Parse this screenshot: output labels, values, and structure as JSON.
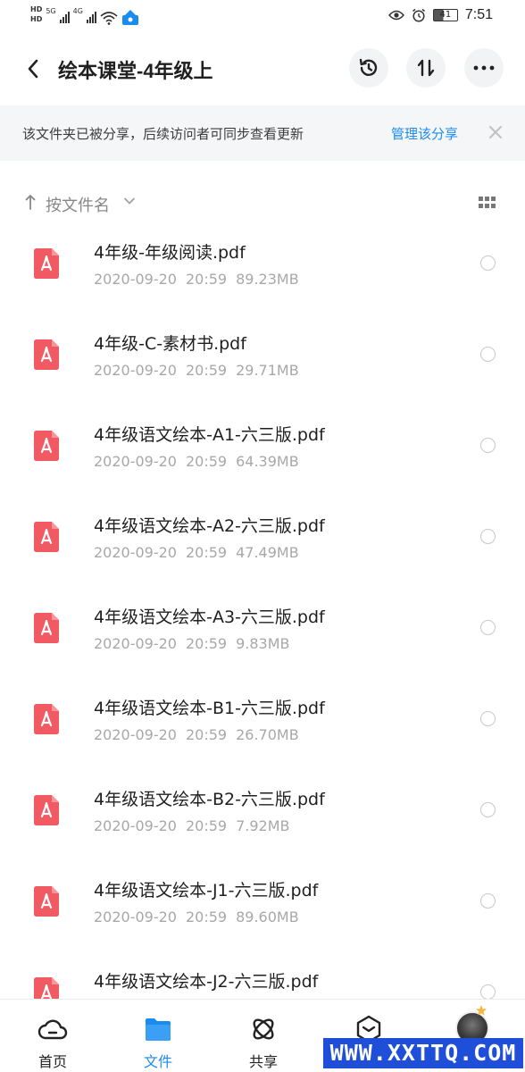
{
  "status_bar": {
    "hd_tags": [
      "HD",
      "HD"
    ],
    "network": [
      "5G",
      "4G"
    ],
    "battery": "41",
    "time": "7:51"
  },
  "header": {
    "title": "绘本课堂-4年级上"
  },
  "share_banner": {
    "message": "该文件夹已被分享，后续访问者可同步查看更新",
    "manage_label": "管理该分享"
  },
  "sort": {
    "label": "按文件名"
  },
  "files": [
    {
      "name": "4年级-年级阅读.pdf",
      "date": "2020-09-20",
      "time": "20:59",
      "size": "89.23MB"
    },
    {
      "name": "4年级-C-素材书.pdf",
      "date": "2020-09-20",
      "time": "20:59",
      "size": "29.71MB"
    },
    {
      "name": "4年级语文绘本-A1-六三版.pdf",
      "date": "2020-09-20",
      "time": "20:59",
      "size": "64.39MB"
    },
    {
      "name": "4年级语文绘本-A2-六三版.pdf",
      "date": "2020-09-20",
      "time": "20:59",
      "size": "47.49MB"
    },
    {
      "name": "4年级语文绘本-A3-六三版.pdf",
      "date": "2020-09-20",
      "time": "20:59",
      "size": "9.83MB"
    },
    {
      "name": "4年级语文绘本-B1-六三版.pdf",
      "date": "2020-09-20",
      "time": "20:59",
      "size": "26.70MB"
    },
    {
      "name": "4年级语文绘本-B2-六三版.pdf",
      "date": "2020-09-20",
      "time": "20:59",
      "size": "7.92MB"
    },
    {
      "name": "4年级语文绘本-J1-六三版.pdf",
      "date": "2020-09-20",
      "time": "20:59",
      "size": "89.60MB"
    },
    {
      "name": "4年级语文绘本-J2-六三版.pdf",
      "date": "",
      "time": "",
      "size": ""
    }
  ],
  "bottom_nav": [
    {
      "label": "首页"
    },
    {
      "label": "文件"
    },
    {
      "label": "共享"
    },
    {
      "label": ""
    },
    {
      "label": ""
    }
  ],
  "watermark": "WWW.XXTTQ.COM",
  "colors": {
    "accent": "#1a8cf0",
    "pdf_red": "#f25a63",
    "meta_gray": "#a8a8a8",
    "banner_bg": "#f5f6f7"
  }
}
